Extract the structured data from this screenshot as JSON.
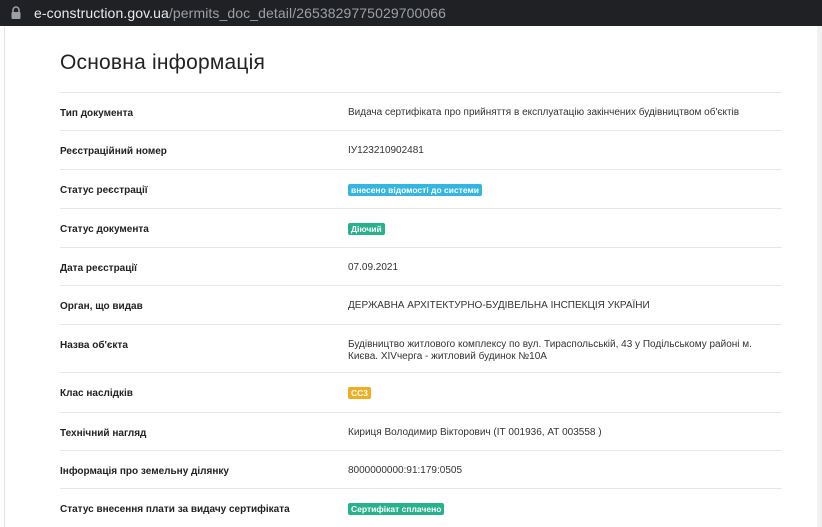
{
  "browser": {
    "url_host": "e-construction.gov.ua",
    "url_path": "/permits_doc_detail/2653829775029700066"
  },
  "page": {
    "title": "Основна інформація"
  },
  "fields": [
    {
      "label": "Тип документа",
      "value": "Видача сертифіката про прийняття в експлуатацію закінчених будівництвом об'єктів"
    },
    {
      "label": "Реєстраційний номер",
      "value": "ІУ123210902481"
    },
    {
      "label": "Статус реєстрації",
      "badge": "внесено відомості до системи",
      "badge_color": "#35b6e0"
    },
    {
      "label": "Статус документа",
      "badge": "Діючий",
      "badge_color": "#27b28d"
    },
    {
      "label": "Дата реєстрації",
      "value": "07.09.2021"
    },
    {
      "label": "Орган, що видав",
      "value": "ДЕРЖАВНА АРХІТЕКТУРНО-БУДІВЕЛЬНА ІНСПЕКЦІЯ УКРАЇНИ"
    },
    {
      "label": "Назва об'єкта",
      "value": "Будівництво житлового комплексу по вул. Тираспольській, 43 у Подільському районі м. Києва. XIVчерга - житловий будинок №10А"
    },
    {
      "label": "Клас наслідків",
      "badge": "СС3",
      "badge_color": "#f0ad1f"
    },
    {
      "label": "Технічний нагляд",
      "value": "Кириця Володимир Вікторович (ІТ 001936, АТ 003558 )"
    },
    {
      "label": "Інформація про земельну ділянку",
      "value": "8000000000:91:179:0505"
    },
    {
      "label": "Статус внесення плати за видачу сертифіката",
      "badge": "Сертифікат сплачено",
      "badge_color": "#27b28d"
    }
  ],
  "icons": {
    "lock": "lock-icon"
  }
}
